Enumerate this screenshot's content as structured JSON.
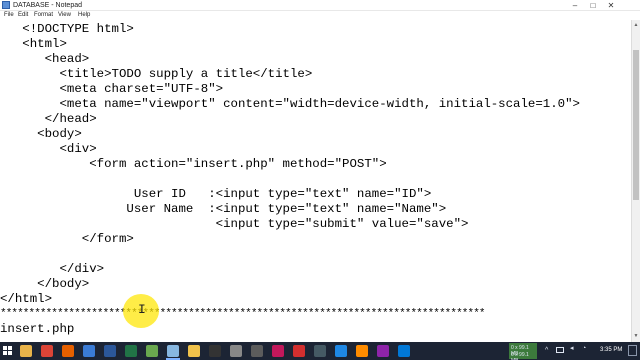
{
  "window": {
    "title": "DATABASE - Notepad",
    "controls": {
      "minimize": "–",
      "maximize": "□",
      "close": "✕"
    }
  },
  "menu": [
    "File",
    "Edit",
    "Format",
    "View",
    "Help"
  ],
  "editor": {
    "lines": [
      "   <!DOCTYPE html>",
      "   <html>",
      "      <head>",
      "        <title>TODO supply a title</title>",
      "        <meta charset=\"UTF-8\">",
      "        <meta name=\"viewport\" content=\"width=device-width, initial-scale=1.0\">",
      "      </head>",
      "     <body>",
      "        <div>",
      "            <form action=\"insert.php\" method=\"POST\">",
      "",
      "                  User ID   :<input type=\"text\" name=\"ID\">",
      "                 User Name  :<input type=\"text\" name=\"Name\">",
      "                             <input type=\"submit\" value=\"save\">",
      "           </form>",
      "",
      "        </div>",
      "     </body>",
      "</html>",
      "*************************************************************************************",
      "insert.php"
    ]
  },
  "scrollbar": {
    "up": "▲",
    "down": "▼"
  },
  "mouse_cursor": "I",
  "taskbar": {
    "apps": [
      "file-explorer-icon",
      "chrome-icon",
      "firefox-icon",
      "media-player-icon",
      "word-icon",
      "excel-icon",
      "netbeans-icon",
      "notepad-icon",
      "folder-icon",
      "terminal-icon",
      "settings-icon",
      "calculator-icon",
      "paint-icon",
      "recorder-icon",
      "camera-icon",
      "store-icon",
      "vlc-icon",
      "photos-icon",
      "mail-icon"
    ],
    "app_colors": [
      "#e8b34a",
      "#db4437",
      "#e66000",
      "#3a7bd5",
      "#2b579a",
      "#217346",
      "#6aa84f",
      "#87b7e0",
      "#f0c24b",
      "#333333",
      "#888888",
      "#5c5c5c",
      "#c2185b",
      "#d32f2f",
      "#455a64",
      "#1e88e5",
      "#ff8c00",
      "#8e24aa",
      "#0078d7"
    ],
    "tray_line1": "0 x 99.1 MB",
    "tray_line2": "0 x 99.1 MB",
    "clock": "3:35 PM"
  }
}
